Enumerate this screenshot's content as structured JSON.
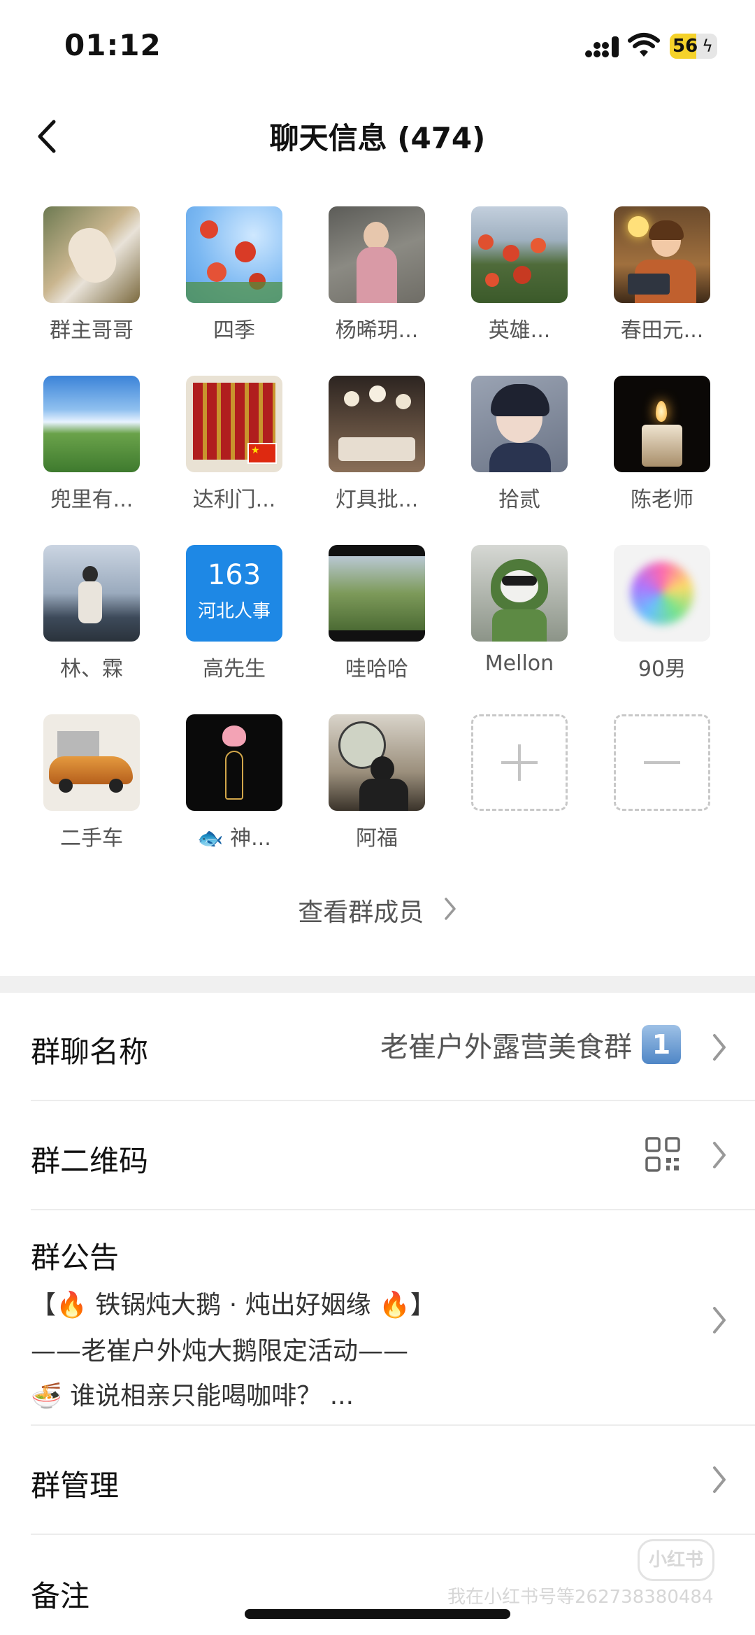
{
  "status_bar": {
    "time": "01:12",
    "battery_level": "56",
    "battery_fraction": 0.56
  },
  "header": {
    "title": "聊天信息 (474)"
  },
  "members": [
    {
      "name": "群主哥哥",
      "avatar": "photo-hands-food"
    },
    {
      "name": "四季",
      "avatar": "red-flowers-blue-sky"
    },
    {
      "name": "杨晞玥...",
      "avatar": "woman-in-pink-portrait"
    },
    {
      "name": "英雄...",
      "avatar": "red-flower-tree"
    },
    {
      "name": "春田元...",
      "avatar": "cartoon-woman-laptop"
    },
    {
      "name": "兜里有...",
      "avatar": "green-hills-blue-sky"
    },
    {
      "name": "达利门...",
      "avatar": "red-gate-china-flag"
    },
    {
      "name": "灯具批...",
      "avatar": "lamp-showroom"
    },
    {
      "name": "拾贰",
      "avatar": "anime-boy"
    },
    {
      "name": "陈老师",
      "avatar": "candle-dark"
    },
    {
      "name": "林、霖",
      "avatar": "person-seaside-rocks"
    },
    {
      "name": "高先生",
      "avatar": "163-hebei-renshi",
      "avatar_text_top": "163",
      "avatar_text_bottom": "河北人事"
    },
    {
      "name": "哇哈哈",
      "avatar": "landscape-willow"
    },
    {
      "name": "Mellon",
      "avatar": "bear-in-green-hoodie"
    },
    {
      "name": "90男",
      "avatar": "colorful-powder-burst"
    },
    {
      "name": "二手车",
      "avatar": "orange-sports-car"
    },
    {
      "name": "🐟 神...",
      "avatar": "lotus-praying-hands"
    },
    {
      "name": "阿福",
      "avatar": "man-tea-ceremony"
    }
  ],
  "view_members_label": "查看群成员",
  "settings": {
    "group_name_label": "群聊名称",
    "group_name_value": "老崔户外露营美食群",
    "group_name_badge": "1",
    "qr_label": "群二维码",
    "announcement_label": "群公告",
    "announcement_lines": [
      "【🔥 铁锅炖大鹅 · 炖出好姻缘 🔥】",
      "——老崔户外炖大鹅限定活动——",
      "🍜 谁说相亲只能喝咖啡？ ..."
    ],
    "manage_label": "群管理",
    "remark_label": "备注"
  },
  "watermark": {
    "logo": "小红书",
    "text": "我在小红书号等262738380484"
  },
  "colors": {
    "accent_badge": "#4f86c6",
    "divider": "#f0f0f0",
    "text_secondary": "#555555"
  }
}
